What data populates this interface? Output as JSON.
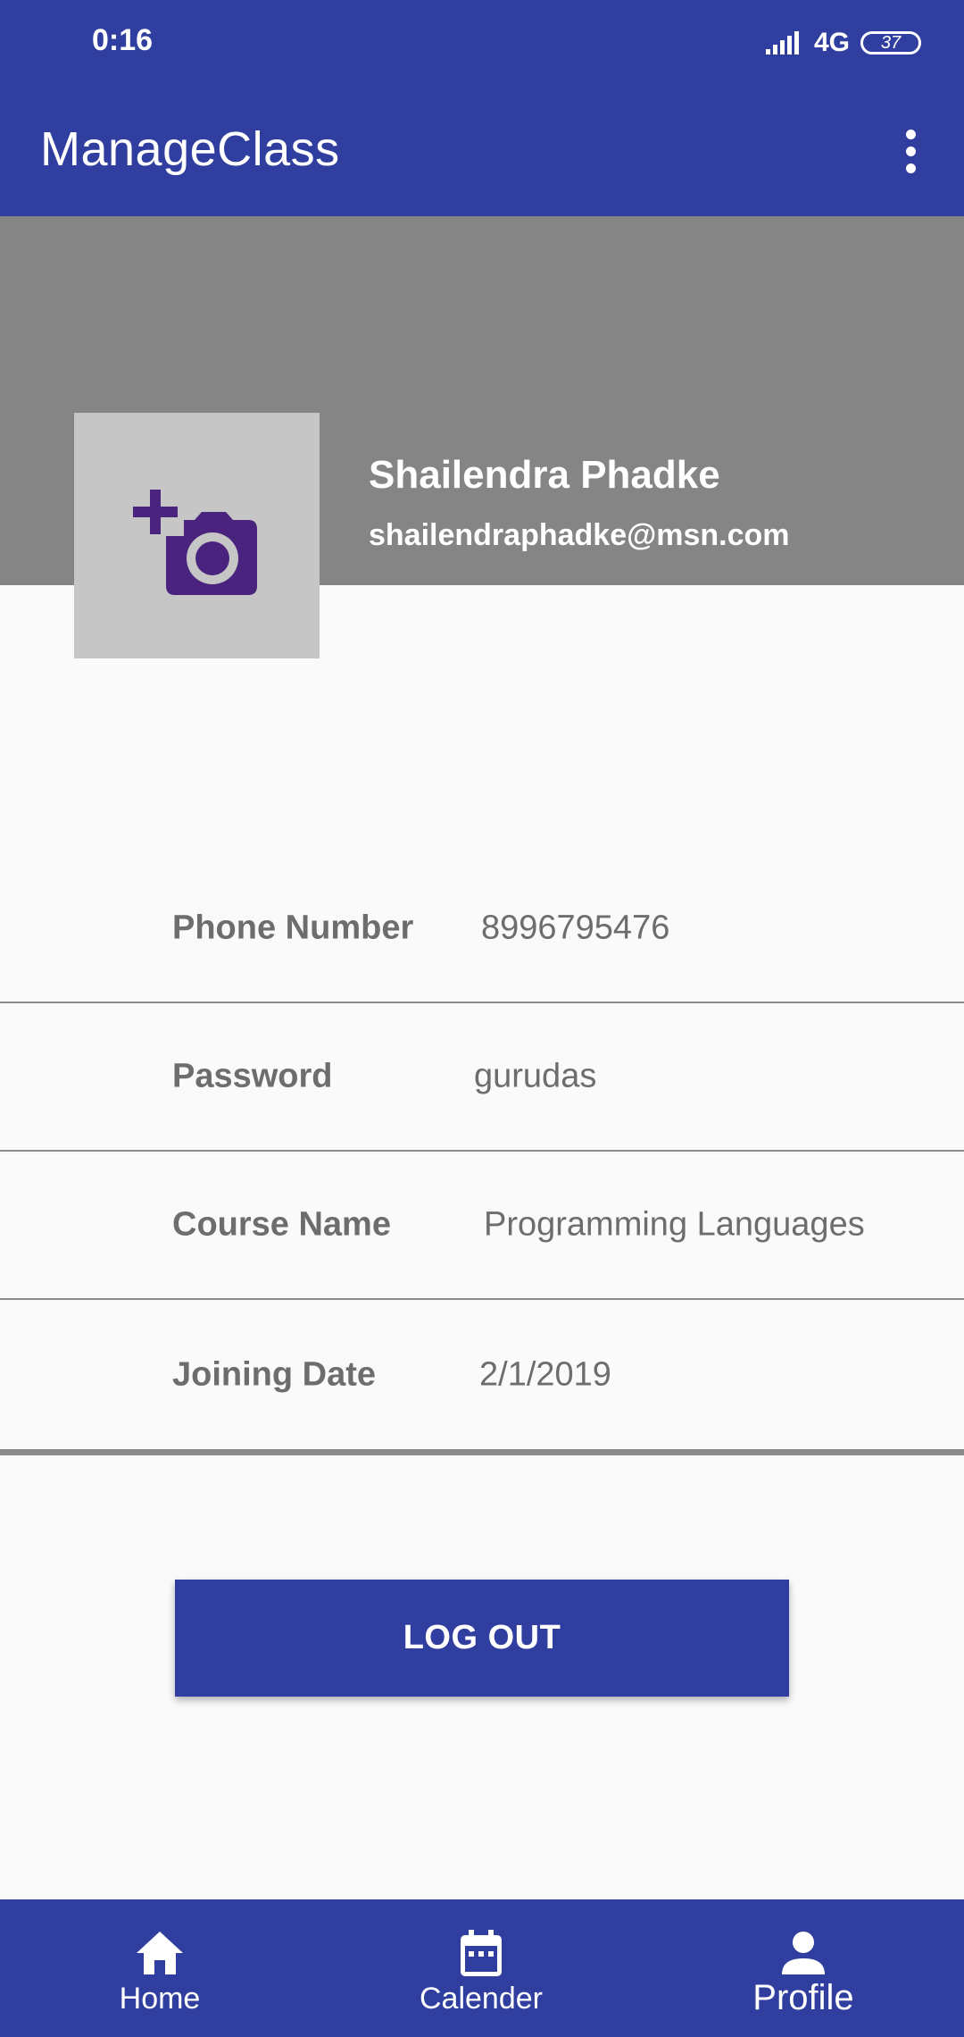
{
  "status_bar": {
    "time": "0:16",
    "network": "4G",
    "battery": "37"
  },
  "app_bar": {
    "title": "ManageClass",
    "menu_icon": "more-vertical-icon"
  },
  "profile": {
    "photo_icon": "add-a-photo-icon",
    "name": "Shailendra Phadke",
    "email": "shailendraphadke@msn.com"
  },
  "details": [
    {
      "label": "Phone Number",
      "value": "8996795476"
    },
    {
      "label": "Password",
      "value": "gurudas"
    },
    {
      "label": "Course Name",
      "value": "Programming Languages"
    },
    {
      "label": "Joining Date",
      "value": "2/1/2019"
    }
  ],
  "logout_label": "LOG OUT",
  "bottom_nav": [
    {
      "label": "Home",
      "icon": "home-icon"
    },
    {
      "label": "Calender",
      "icon": "calendar-icon"
    },
    {
      "label": "Profile",
      "icon": "person-icon"
    }
  ],
  "colors": {
    "primary": "#303f9f",
    "header_band": "#858585",
    "photo_bg": "#c6c6c6",
    "photo_icon": "#4a237e",
    "text_gray": "#6d6d6d"
  }
}
